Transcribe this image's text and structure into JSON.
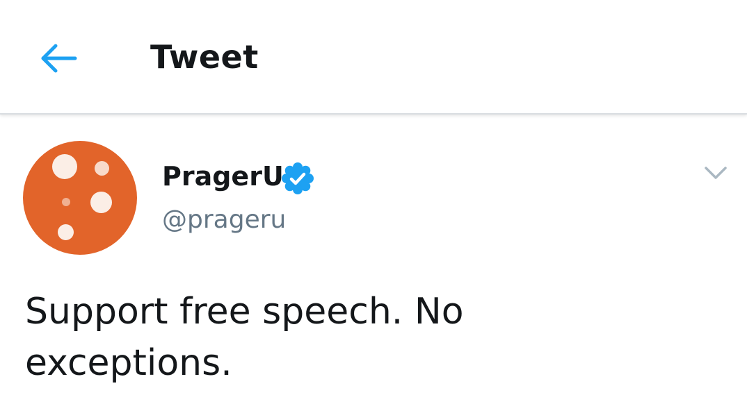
{
  "header": {
    "back_icon": "arrow-left-icon",
    "title": "Tweet"
  },
  "author": {
    "avatar_icon": "prageru-logo-avatar",
    "name": "PragerU",
    "verified_icon": "verified-badge-icon",
    "handle": "@prageru"
  },
  "menu": {
    "caret_icon": "chevron-down-icon"
  },
  "tweet": {
    "text": "Support free speech. No exceptions."
  },
  "colors": {
    "accent": "#1da1f2",
    "avatar_bg": "#e2642a",
    "text_primary": "#14171a",
    "text_secondary": "#657786",
    "caret": "#aab8c2",
    "divider": "#d9dde1"
  }
}
